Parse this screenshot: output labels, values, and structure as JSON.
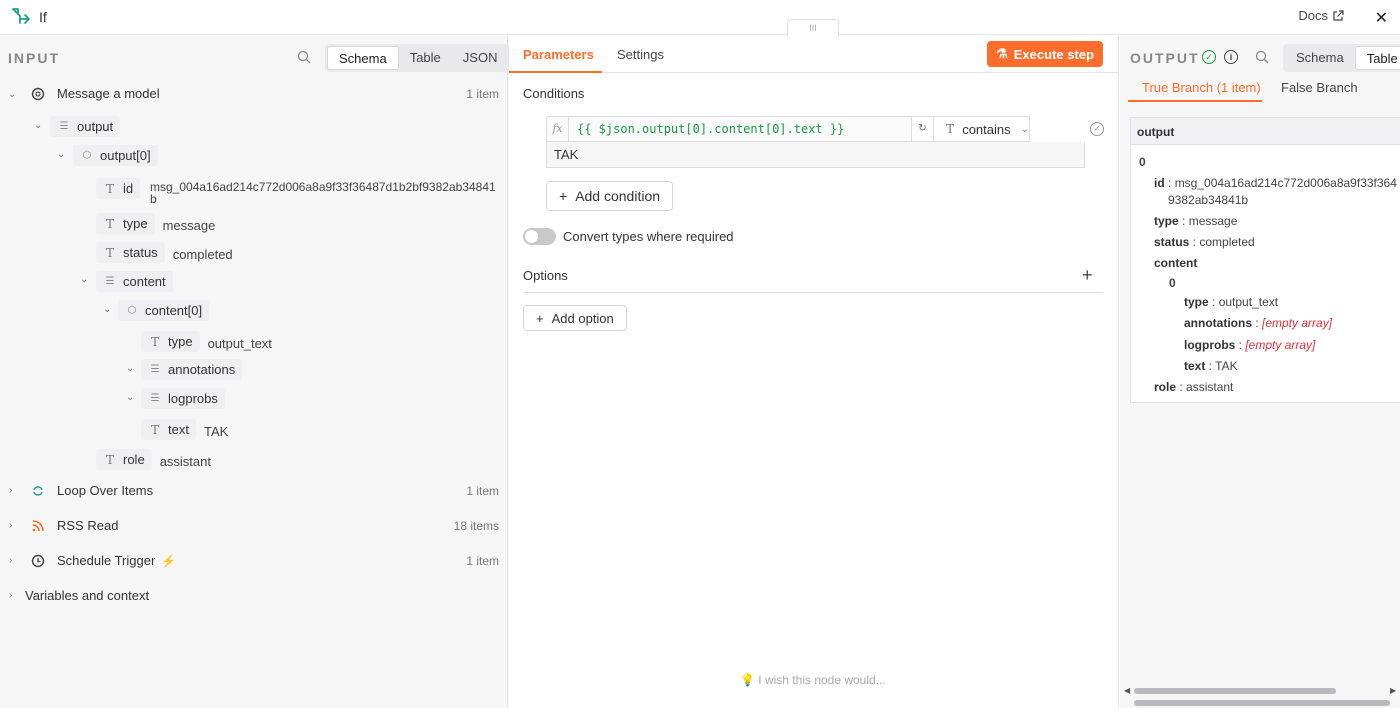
{
  "topbar": {
    "title": "If",
    "docs_label": "Docs",
    "handle": "III"
  },
  "input": {
    "header": "INPUT",
    "views": [
      "Schema",
      "Table",
      "JSON"
    ],
    "active_view": "Schema",
    "tree": {
      "message_node": {
        "label": "Message a model",
        "count": "1 item"
      },
      "output": "output",
      "output0": "output[0]",
      "id_key": "id",
      "id_val_line1": "msg_004a16ad214c772d006a8a9f33f36487d1b2bf9382ab34841",
      "id_val_line2": "b",
      "type_key": "type",
      "type_val": "message",
      "status_key": "status",
      "status_val": "completed",
      "content": "content",
      "content0": "content[0]",
      "ctype_key": "type",
      "ctype_val": "output_text",
      "annotations": "annotations",
      "logprobs": "logprobs",
      "text_key": "text",
      "text_val": "TAK",
      "role_key": "role",
      "role_val": "assistant"
    },
    "nodes": [
      {
        "label": "Loop Over Items",
        "count": "1 item"
      },
      {
        "label": "RSS Read",
        "count": "18 items"
      },
      {
        "label": "Schedule Trigger",
        "count": "1 item"
      }
    ],
    "variables": "Variables and context"
  },
  "params": {
    "tabs": [
      "Parameters",
      "Settings"
    ],
    "execute_label": "Execute step",
    "conditions_label": "Conditions",
    "condition": {
      "fx": "fx",
      "expression": "{{ $json.output[0].content[0].text }}",
      "operator": "contains",
      "value": "TAK"
    },
    "add_condition_label": "Add condition",
    "convert_label": "Convert types where required",
    "options_label": "Options",
    "add_option_label": "Add option",
    "wish_label": "I wish this node would..."
  },
  "output": {
    "header": "OUTPUT",
    "views": [
      "Schema",
      "Table"
    ],
    "active_view": "Table",
    "branches": [
      "True Branch (1 item)",
      "False Branch"
    ],
    "card_header": "output",
    "index0": "0",
    "id_key": "id",
    "id_val_line1": "msg_004a16ad214c772d006a8a9f33f364",
    "id_val_line2": "9382ab34841b",
    "type_key": "type",
    "type_val": "message",
    "status_key": "status",
    "status_val": "completed",
    "content_key": "content",
    "content_index": "0",
    "ctype_key": "type",
    "ctype_val": "output_text",
    "annotations_key": "annotations",
    "annotations_val": "[empty array]",
    "logprobs_key": "logprobs",
    "logprobs_val": "[empty array]",
    "text_key": "text",
    "text_val": "TAK",
    "role_key": "role",
    "role_val": "assistant"
  },
  "colors": {
    "accent": "#ff6d2c",
    "success": "#1a9b45",
    "error": "#e0313b"
  }
}
